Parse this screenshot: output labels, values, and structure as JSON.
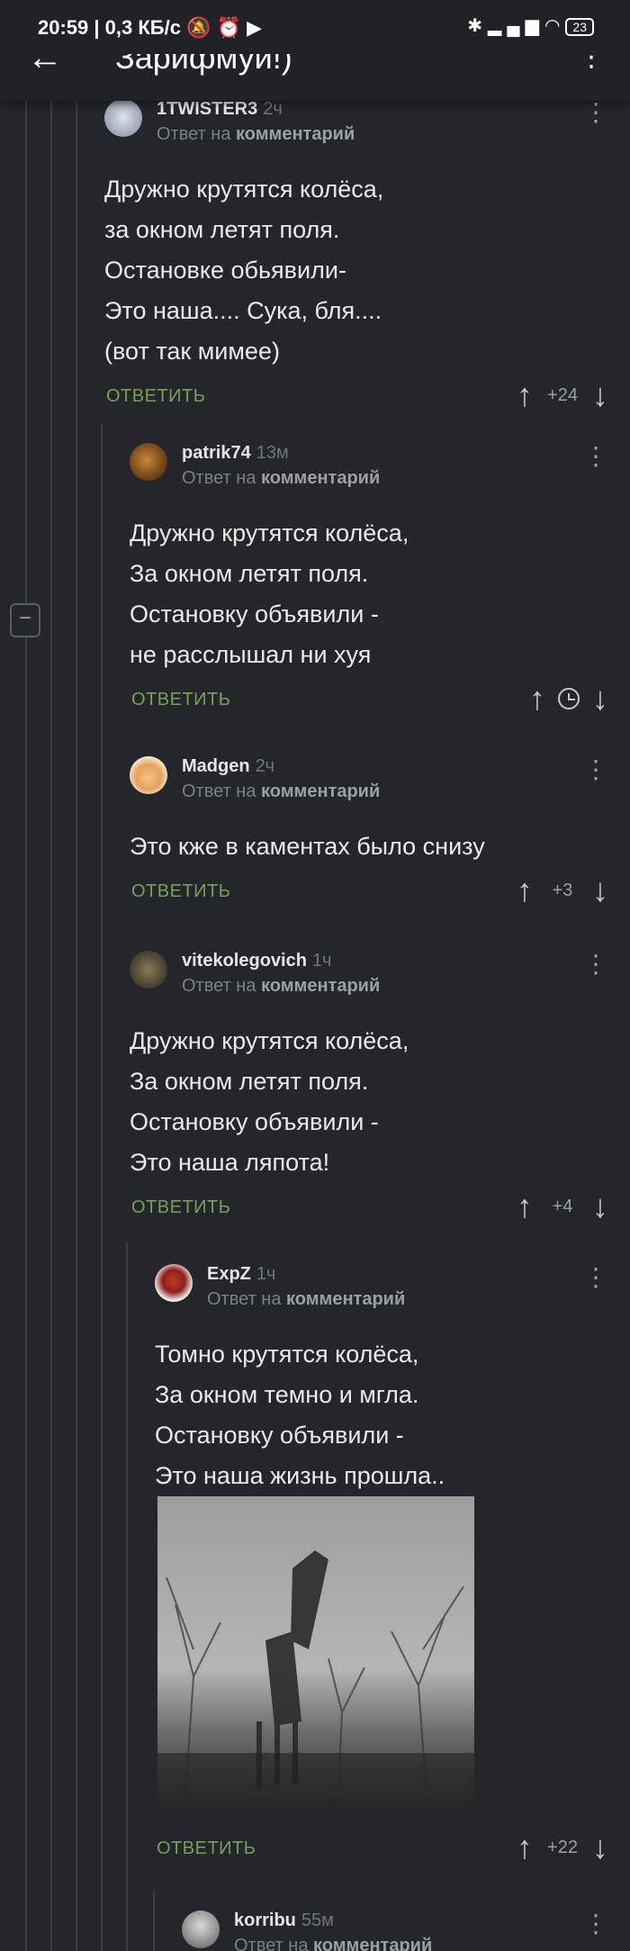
{
  "status_bar": {
    "time": "20:59",
    "speed": "0,3 КБ/с",
    "battery": "23"
  },
  "header": {
    "title": "Зарифмуй!)"
  },
  "labels": {
    "reply_to": "Ответ на",
    "comment_word": "комментарий",
    "reply": "ОТВЕТИТЬ"
  },
  "comments": [
    {
      "author": "1TWISTER3",
      "time": "2ч",
      "lines": [
        "Дружно крутятся колёса,",
        "за окном летят поля.",
        "Остановке обьявили-",
        "Это наша.... Сука, бля....",
        "(вот так мимее)"
      ],
      "score": "+24"
    },
    {
      "author": "patrik74",
      "time": "13м",
      "lines": [
        "Дружно крутятся колёса,",
        "За окном летят поля.",
        "Остановку объявили -",
        "не расслышал ни хуя"
      ],
      "score": ""
    },
    {
      "author": "Madgen",
      "time": "2ч",
      "lines": [
        "Это кже в каментах было снизу"
      ],
      "score": "+3"
    },
    {
      "author": "vitekolegovich",
      "time": "1ч",
      "lines": [
        "Дружно крутятся колёса,",
        "За окном летят поля.",
        "Остановку объявили -",
        "Это наша ляпота!"
      ],
      "score": "+4"
    },
    {
      "author": "ExpZ",
      "time": "1ч",
      "lines": [
        "Томно крутятся колёса,",
        "За окном темно и мгла.",
        "Остановку объявили -",
        "Это наша жизнь прошла.."
      ],
      "score": "+22"
    },
    {
      "author": "korribu",
      "time": "55м",
      "lines": [],
      "score": ""
    }
  ]
}
